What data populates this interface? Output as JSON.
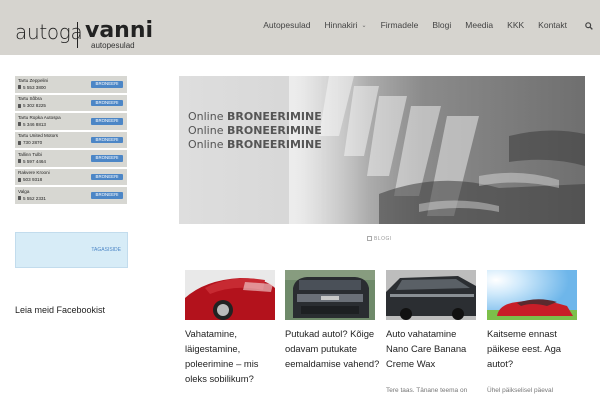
{
  "header": {
    "logo": {
      "part1": "autoga",
      "part2": "vanni",
      "sub": "autopesulad"
    },
    "nav": [
      {
        "label": "Autopesulad",
        "dropdown": false
      },
      {
        "label": "Hinnakiri",
        "dropdown": true
      },
      {
        "label": "Firmadele",
        "dropdown": false
      },
      {
        "label": "Blogi",
        "dropdown": false
      },
      {
        "label": "Meedia",
        "dropdown": false
      },
      {
        "label": "KKK",
        "dropdown": false
      },
      {
        "label": "Kontakt",
        "dropdown": false
      }
    ],
    "search_icon": "search-icon"
  },
  "dealers": [
    {
      "name": "Tartu Zeppelini",
      "phone": "5 553 3800",
      "button": "BRONEERI"
    },
    {
      "name": "Tartu Sõbra",
      "phone": "5 302 8225",
      "button": "BRONEERI"
    },
    {
      "name": "Tartu Ropka Autospa",
      "phone": "5 346 8813",
      "button": "BRONEERI"
    },
    {
      "name": "Tartu United Motors",
      "phone": "730 2870",
      "button": "BRONEERI"
    },
    {
      "name": "Tallinn Tulbi",
      "phone": "5 597 4464",
      "button": "BRONEERI"
    },
    {
      "name": "Rakvere Krooni",
      "phone": "503 9318",
      "button": "BRONEERI"
    },
    {
      "name": "Valga",
      "phone": "5 552 2331",
      "button": "BRONEERI"
    }
  ],
  "feedback": {
    "label": "TAGASISIDE"
  },
  "facebook": {
    "title": "Leia meid Facebookist"
  },
  "hero": {
    "slogans": [
      {
        "light": "Online ",
        "bold": "BRONEERIMINE"
      },
      {
        "light": "Online ",
        "bold": "BRONEERIMINE"
      },
      {
        "light": "Online ",
        "bold": "BRONEERIMINE"
      }
    ],
    "caption": "BLOGI"
  },
  "posts": [
    {
      "title": "Vahatamine, läigestamine, poleerimine – mis oleks sobilikum?",
      "excerpt": ""
    },
    {
      "title": "Putukad autol? Kõige odavam putukate eemaldamise vahend?",
      "excerpt": ""
    },
    {
      "title": "Auto vahatamine Nano Care Banana Creme Wax",
      "excerpt": "Tere taas. Tänane teema on"
    },
    {
      "title": "Kaitseme ennast päikese eest. Aga autot?",
      "excerpt": "Ühel päikselisel päeval"
    }
  ],
  "colors": {
    "header_bg": "#d6d4cf",
    "button_blue": "#4c86c6",
    "feedback_bg": "#d7ecf7"
  }
}
